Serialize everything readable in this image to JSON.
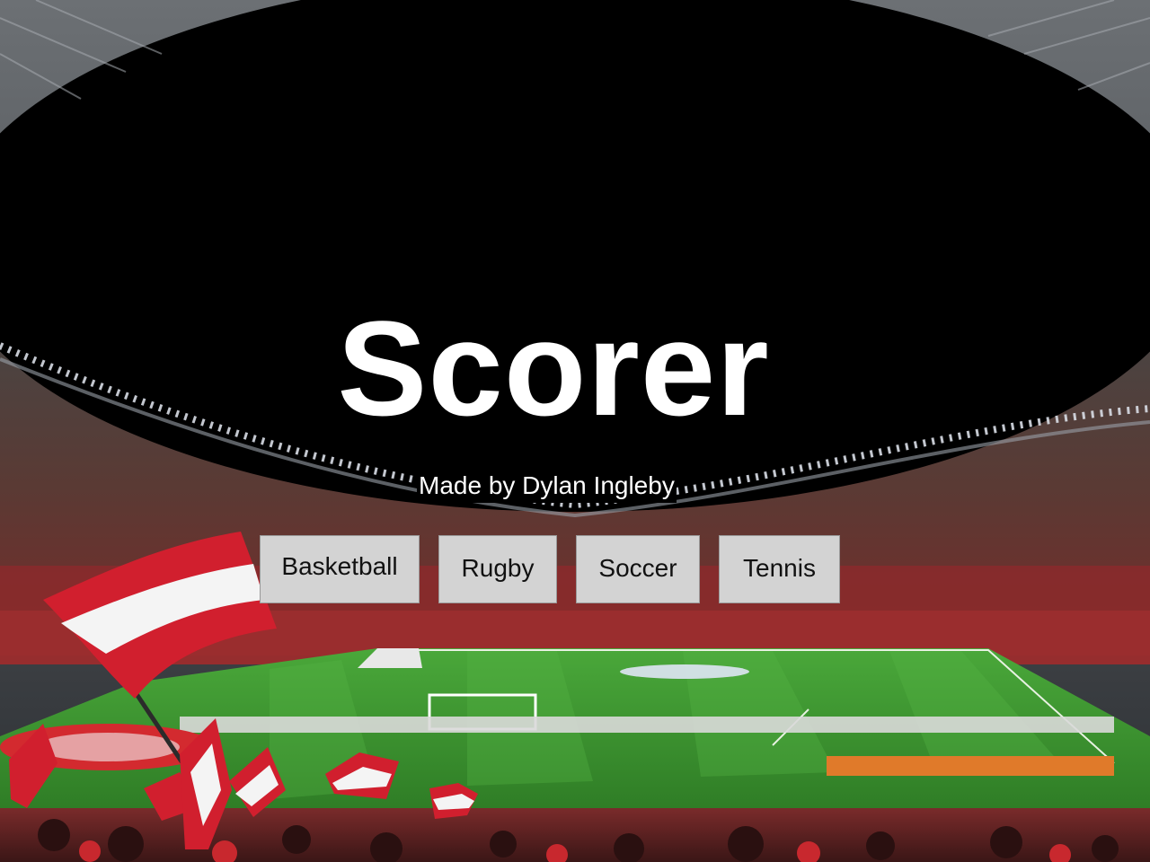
{
  "title": "Scorer",
  "credit": "Made by Dylan Ingleby",
  "sports": {
    "basketball": "Basketball",
    "rugby": "Rugby",
    "soccer": "Soccer",
    "tennis": "Tennis"
  },
  "colors": {
    "button_bg": "#d3d3d3",
    "title_text": "#ffffff",
    "pitch_green": "#3f9a2e",
    "flag_red": "#d11f2e"
  }
}
